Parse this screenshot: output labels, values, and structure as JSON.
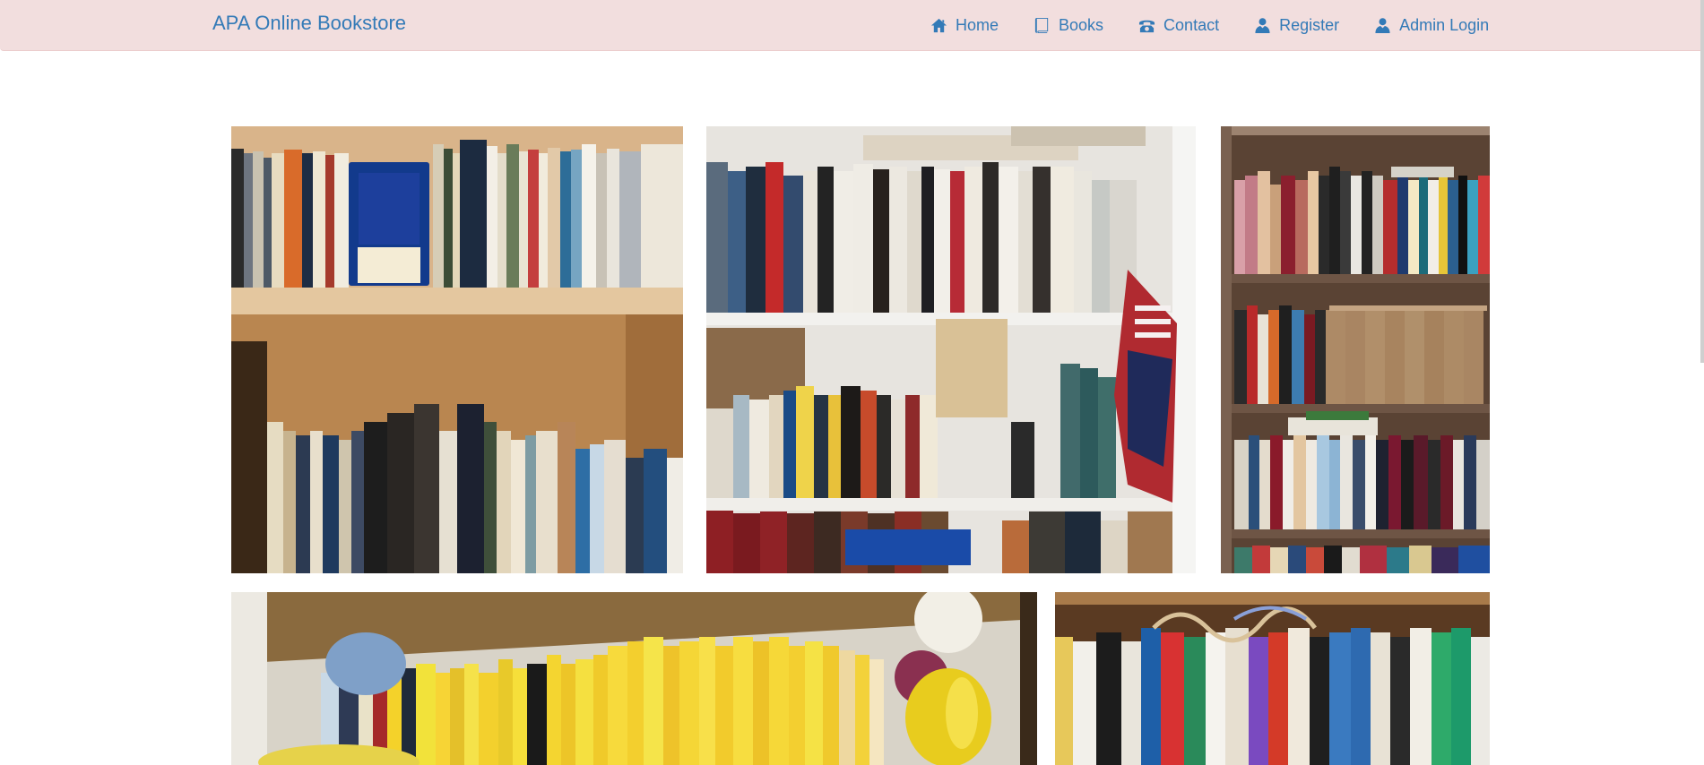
{
  "navbar": {
    "brand": "APA Online Bookstore",
    "items": [
      {
        "label": "Home",
        "icon": "home-icon"
      },
      {
        "label": "Books",
        "icon": "book-icon"
      },
      {
        "label": "Contact",
        "icon": "phone-icon"
      },
      {
        "label": "Register",
        "icon": "user-icon"
      },
      {
        "label": "Admin Login",
        "icon": "user-icon"
      }
    ]
  },
  "colors": {
    "navbar_bg": "#f2dede",
    "link": "#337ab7"
  },
  "gallery": {
    "photos": [
      {
        "name": "bookshelf-photo-1"
      },
      {
        "name": "bookshelf-photo-2"
      },
      {
        "name": "bookshelf-photo-3"
      },
      {
        "name": "bookshelf-photo-4"
      },
      {
        "name": "bookshelf-photo-5"
      }
    ]
  }
}
